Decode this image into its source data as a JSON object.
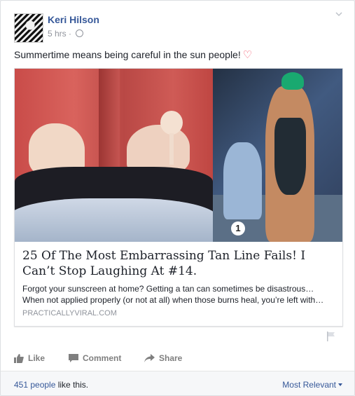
{
  "post": {
    "author": "Keri Hilson",
    "time": "5 hrs",
    "separator": "·",
    "message": "Summertime means being careful in the sun people!",
    "emoji": "♡"
  },
  "attachment": {
    "badge": "1",
    "title": "25 Of The Most Embarrassing Tan Line Fails! I Can’t Stop Laughing At #14.",
    "desc_line1": "Forgot your sunscreen at home? Getting a tan can sometimes be disastrous…",
    "desc_line2": "When not applied properly (or not at all) when those burns heal, you’re left with…",
    "domain": "PRACTICALLYVIRAL.COM"
  },
  "actions": {
    "like": "Like",
    "comment": "Comment",
    "share": "Share"
  },
  "footer": {
    "like_count": "451 people",
    "like_text": " like this.",
    "sort": "Most Relevant"
  },
  "icons": {
    "avatar": "profile-photo",
    "globe": "globe-icon",
    "chevron": "chevron-down-icon",
    "heart": "heart-emoji",
    "flag": "flag-icon",
    "like": "thumbs-up-icon",
    "comment": "comment-icon",
    "share": "share-arrow-icon"
  },
  "colors": {
    "link": "#365899",
    "muted": "#90949c",
    "heart": "#f35369"
  }
}
